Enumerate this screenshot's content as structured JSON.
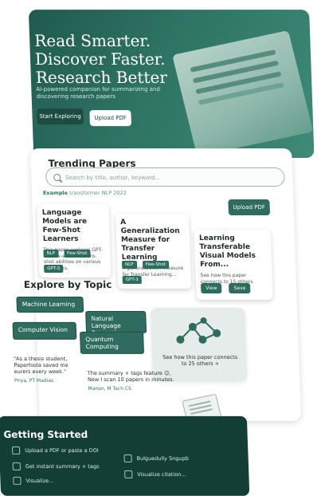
{
  "hero": {
    "title_lines": [
      "Read Smarter.",
      "Discover Faster.",
      "Research Better"
    ],
    "subtitle": "AI-powered companion for summarizing and discovering research papers",
    "primary_button": "Start Exploring",
    "secondary_button": "Upload PDF"
  },
  "trending": {
    "title": "Trending Papers",
    "search_placeholder": "Search by title, author, keyword...",
    "example_label": "Example",
    "example_value": "transformer NLP 2022",
    "upload_button": "Upload PDF",
    "papers": [
      {
        "title": "Language Models are Few-Shot Learners",
        "desc": "This paper explores GPT-3's few-shot and zero-shot abilities on various NLP tasks.",
        "tags": [
          "NLP",
          "Few-Shot",
          "GPT-3"
        ]
      },
      {
        "title": "A Generalization Measure for Transfer Learning",
        "desc": "A generalization measure for Transfer Learning...",
        "tags": [
          "NLP",
          "Few-Shot",
          "GPT-3"
        ]
      },
      {
        "title": "Learning Transferable Visual Models From...",
        "desc": "See how this paper connects to 15 others",
        "buttons": [
          "View",
          "Save"
        ]
      }
    ]
  },
  "explore": {
    "title": "Explore by Topic",
    "topics": [
      "Machine Learning",
      "Natural Language Processing",
      "Computer Vision",
      "Quantum Computing"
    ],
    "graph_caption": "See how this paper connects to 25 others +"
  },
  "testimonials": [
    {
      "text": "\"As a thesis student, Paperfoola saved me eurers every week.\"",
      "author": "Priya, PT Madias"
    },
    {
      "text": "The summary + tags feature ☺, New I scan 10 papers in minutes.",
      "author": "Manon, M Tach CS"
    }
  ],
  "getting_started": {
    "title": "Getting Started",
    "items": [
      "Upload a PDF or paste a DOI",
      "Get instant summary + tags",
      "Visualize...",
      "Bulguedully Sngupb",
      "Visualize citation..."
    ]
  },
  "colors": {
    "brand": "#2f6b5e",
    "hero": "#2f7464",
    "dark": "#123e36"
  }
}
